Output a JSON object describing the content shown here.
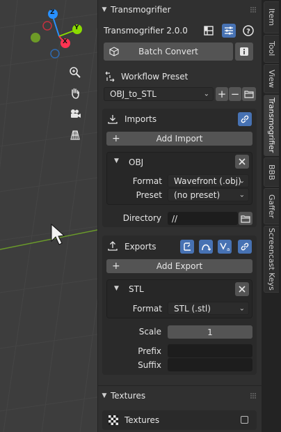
{
  "colors": {
    "accent_blue": "#4772b3",
    "axis_x": "#ff3352",
    "axis_y": "#8bdc00",
    "axis_z": "#2890ff"
  },
  "gizmo": {
    "z_label": "Z",
    "y_label": "Y",
    "x_label": "X"
  },
  "viewport_icons": [
    "zoom-icon",
    "hand-pan-icon",
    "camera-icon",
    "grid-ortho-icon"
  ],
  "panel": {
    "header": "Transmogrifier",
    "version": "Transmogrifier 2.0.0",
    "batch_convert": "Batch Convert",
    "workflow_label": "Workflow Preset",
    "workflow_value": "OBJ_to_STL",
    "imports": {
      "title": "Imports",
      "add": "Add Import",
      "item": {
        "name": "OBJ",
        "format_label": "Format",
        "format_value": "Wavefront (.obj)",
        "preset_label": "Preset",
        "preset_value": "(no preset)",
        "directory_label": "Directory",
        "directory_value": "//"
      }
    },
    "exports": {
      "title": "Exports",
      "add": "Add Export",
      "item": {
        "name": "STL",
        "format_label": "Format",
        "format_value": "STL (.stl)",
        "scale_label": "Scale",
        "scale_value": "1",
        "prefix_label": "Prefix",
        "prefix_value": "",
        "suffix_label": "Suffix",
        "suffix_value": ""
      }
    },
    "textures": {
      "header": "Textures",
      "label": "Textures"
    }
  },
  "tabs": [
    "Item",
    "Tool",
    "View",
    "Transmogrifier",
    "BBB",
    "Gaffer",
    "Screencast Keys"
  ]
}
